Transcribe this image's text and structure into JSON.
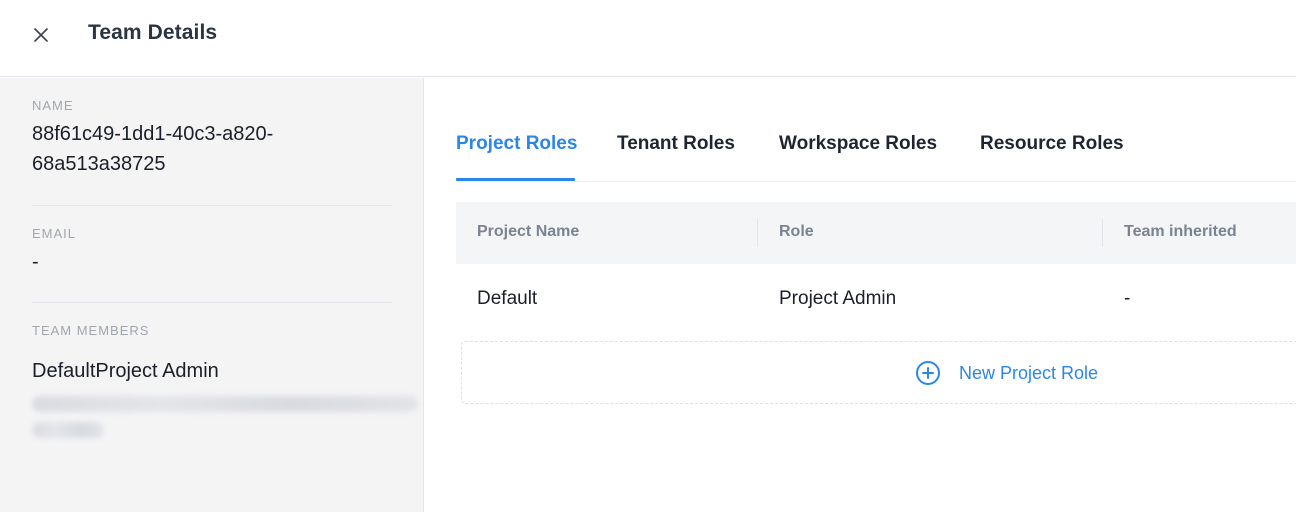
{
  "header": {
    "title": "Team Details"
  },
  "sidebar": {
    "name": {
      "label": "NAME",
      "value": "88f61c49-1dd1-40c3-a820-68a513a38725"
    },
    "email": {
      "label": "EMAIL",
      "value": "-"
    },
    "team_members": {
      "label": "TEAM MEMBERS",
      "value": "DefaultProject Admin"
    }
  },
  "tabs": [
    {
      "label": "Project Roles",
      "active": true
    },
    {
      "label": "Tenant Roles"
    },
    {
      "label": "Workspace Roles"
    },
    {
      "label": "Resource Roles"
    }
  ],
  "table": {
    "columns": [
      "Project Name",
      "Role",
      "Team inherited"
    ],
    "rows": [
      {
        "project_name": "Default",
        "role": "Project Admin",
        "team_inherited": "-"
      }
    ]
  },
  "actions": {
    "new_project_role": "New Project Role"
  },
  "colors": {
    "accent": "#2c86ea",
    "sidebar_bg": "#f4f4f5",
    "table_head_bg": "#f4f5f7"
  }
}
